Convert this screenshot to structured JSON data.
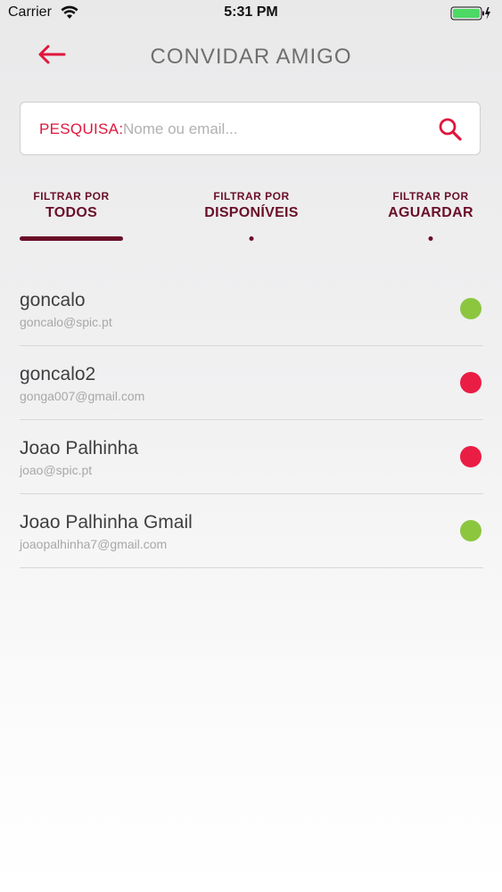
{
  "status_bar": {
    "carrier": "Carrier",
    "time": "5:31 PM",
    "battery_color": "#4cd964"
  },
  "nav": {
    "title": "CONVIDAR AMIGO",
    "back_icon": "arrow-left-icon",
    "accent": "#e0163c"
  },
  "search": {
    "label": "PESQUISA:",
    "placeholder": "Nome ou email...",
    "value": "",
    "icon": "search-icon"
  },
  "tabs": [
    {
      "small": "FILTRAR POR",
      "big": "TODOS",
      "selected": true
    },
    {
      "small": "FILTRAR POR",
      "big": "DISPONÍVEIS",
      "selected": false
    },
    {
      "small": "FILTRAR POR",
      "big": "AGUARDAR",
      "selected": false
    }
  ],
  "tab_color": "#6a0f28",
  "contacts": [
    {
      "name": "goncalo",
      "email": "goncalo@spic.pt",
      "status": "available",
      "status_color": "#8cc63f"
    },
    {
      "name": "goncalo2",
      "email": "gonga007@gmail.com",
      "status": "pending",
      "status_color": "#ea1d45"
    },
    {
      "name": "Joao Palhinha",
      "email": "joao@spic.pt",
      "status": "pending",
      "status_color": "#ea1d45"
    },
    {
      "name": "Joao Palhinha Gmail",
      "email": "joaopalhinha7@gmail.com",
      "status": "available",
      "status_color": "#8cc63f"
    }
  ]
}
